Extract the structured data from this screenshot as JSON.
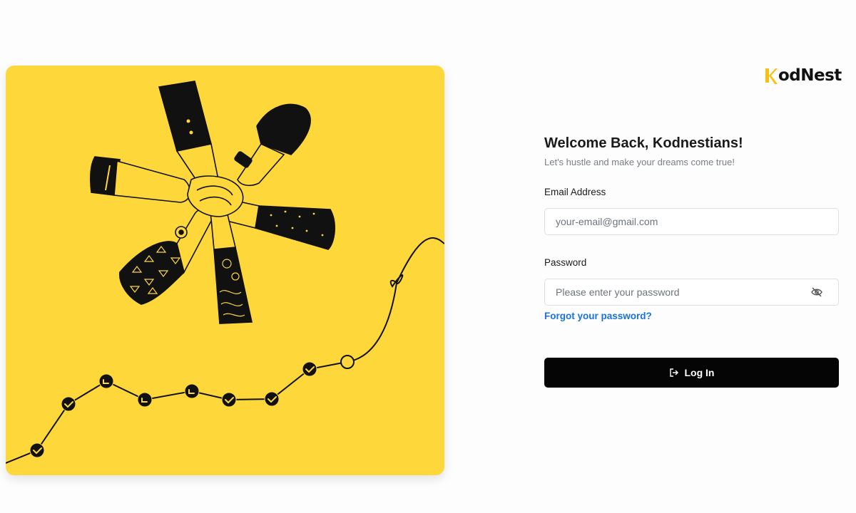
{
  "brand": {
    "name": "odNest",
    "accent": "#fcbf10"
  },
  "illustration": {
    "background": "#fed73b"
  },
  "form": {
    "title": "Welcome Back, Kodnestians!",
    "subtitle": "Let's hustle and make your dreams come true!",
    "email_label": "Email Address",
    "email_placeholder": "your-email@gmail.com",
    "password_label": "Password",
    "password_placeholder": "Please enter your password",
    "forgot_link": "Forgot your password?",
    "login_label": "Log In"
  },
  "icons": {
    "password_toggle": "eye-off-icon",
    "login": "login-arrow-icon"
  }
}
